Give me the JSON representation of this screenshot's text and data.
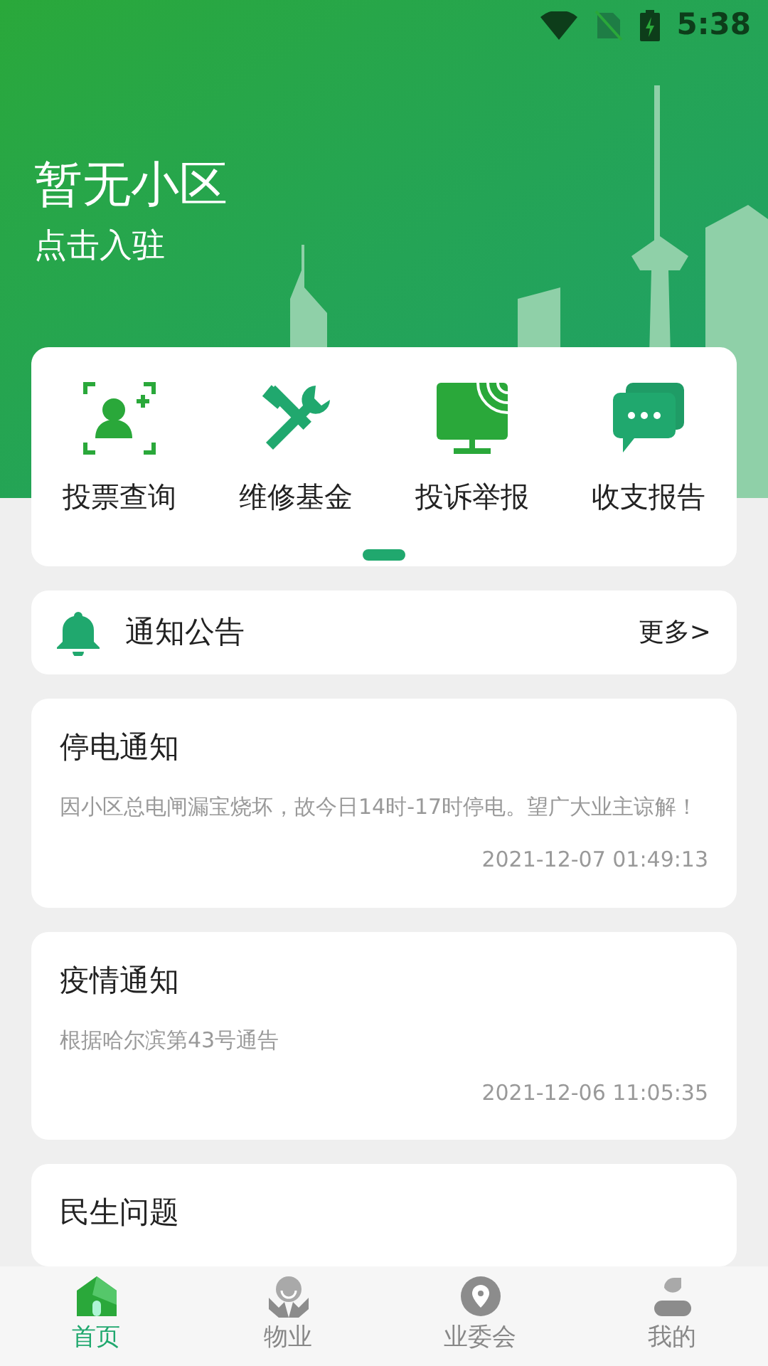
{
  "status_bar": {
    "time": "5:38"
  },
  "header": {
    "title": "暂无小区",
    "subtitle": "点击入驻"
  },
  "quick_actions": [
    {
      "kind": "vote",
      "label": "投票查询"
    },
    {
      "kind": "repair",
      "label": "维修基金"
    },
    {
      "kind": "complaint",
      "label": "投诉举报"
    },
    {
      "kind": "report",
      "label": "收支报告"
    }
  ],
  "pager": [
    {
      "selected": true
    }
  ],
  "notice_bar": {
    "title": "通知公告",
    "more": "更多>"
  },
  "notices": [
    {
      "title": "停电通知",
      "body": "因小区总电闸漏宝烧坏，故今日14时-17时停电。望广大业主谅解！",
      "date": "2021-12-07 01:49:13"
    },
    {
      "title": "疫情通知",
      "body": "根据哈尔滨第43号通告",
      "date": "2021-12-06 11:05:35"
    },
    {
      "title": "民生问题"
    }
  ],
  "bottom_nav": [
    {
      "kind": "home",
      "label": "首页",
      "selected": true
    },
    {
      "kind": "property",
      "label": "物业",
      "selected": false
    },
    {
      "kind": "committee",
      "label": "业委会",
      "selected": false
    },
    {
      "kind": "mine",
      "label": "我的",
      "selected": false
    }
  ]
}
